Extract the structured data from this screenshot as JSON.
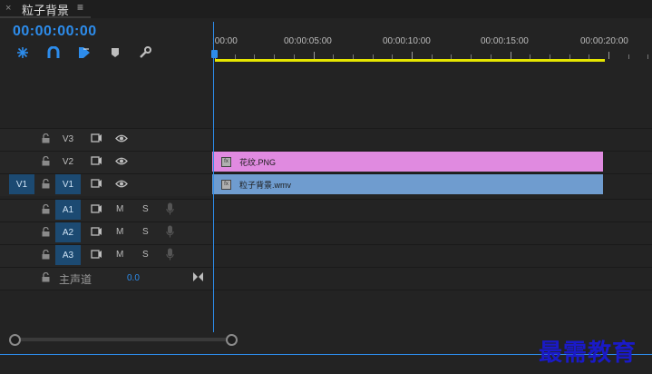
{
  "panel": {
    "title": "粒子背景",
    "close": "×",
    "menu": "≡"
  },
  "timecode": "00:00:00:00",
  "tools": [
    {
      "name": "snap",
      "icon": "⁂"
    },
    {
      "name": "linked-selection",
      "icon": "∩"
    },
    {
      "name": "add-marker",
      "icon": "▶"
    },
    {
      "name": "marker",
      "icon": "▾"
    },
    {
      "name": "settings",
      "icon": "✎"
    }
  ],
  "ruler": {
    "labels": [
      ":00:00",
      "00:00:05:00",
      "00:00:10:00",
      "00:00:15:00",
      "00:00:20:00"
    ]
  },
  "tracks": {
    "video": [
      {
        "source": "",
        "target": "V3",
        "lock": "🔓",
        "sync": "▭",
        "eye": "👁"
      },
      {
        "source": "",
        "target": "V2",
        "lock": "🔓",
        "sync": "▭",
        "eye": "👁"
      },
      {
        "source": "V1",
        "target": "V1",
        "lock": "🔓",
        "sync": "▭",
        "eye": "👁"
      }
    ],
    "audio": [
      {
        "target": "A1",
        "m": "M",
        "s": "S"
      },
      {
        "target": "A2",
        "m": "M",
        "s": "S"
      },
      {
        "target": "A3",
        "m": "M",
        "s": "S"
      }
    ],
    "master": {
      "label": "主声道",
      "value": "0.0"
    }
  },
  "clips": {
    "v2": {
      "name": "花纹.PNG",
      "color": "#e08ae0"
    },
    "v1": {
      "name": "粒子背景.wmv",
      "color": "#6f9ccf"
    }
  },
  "watermark": "最需教育",
  "colors": {
    "accent": "#2d8ceb",
    "workbar": "#e6e600"
  }
}
